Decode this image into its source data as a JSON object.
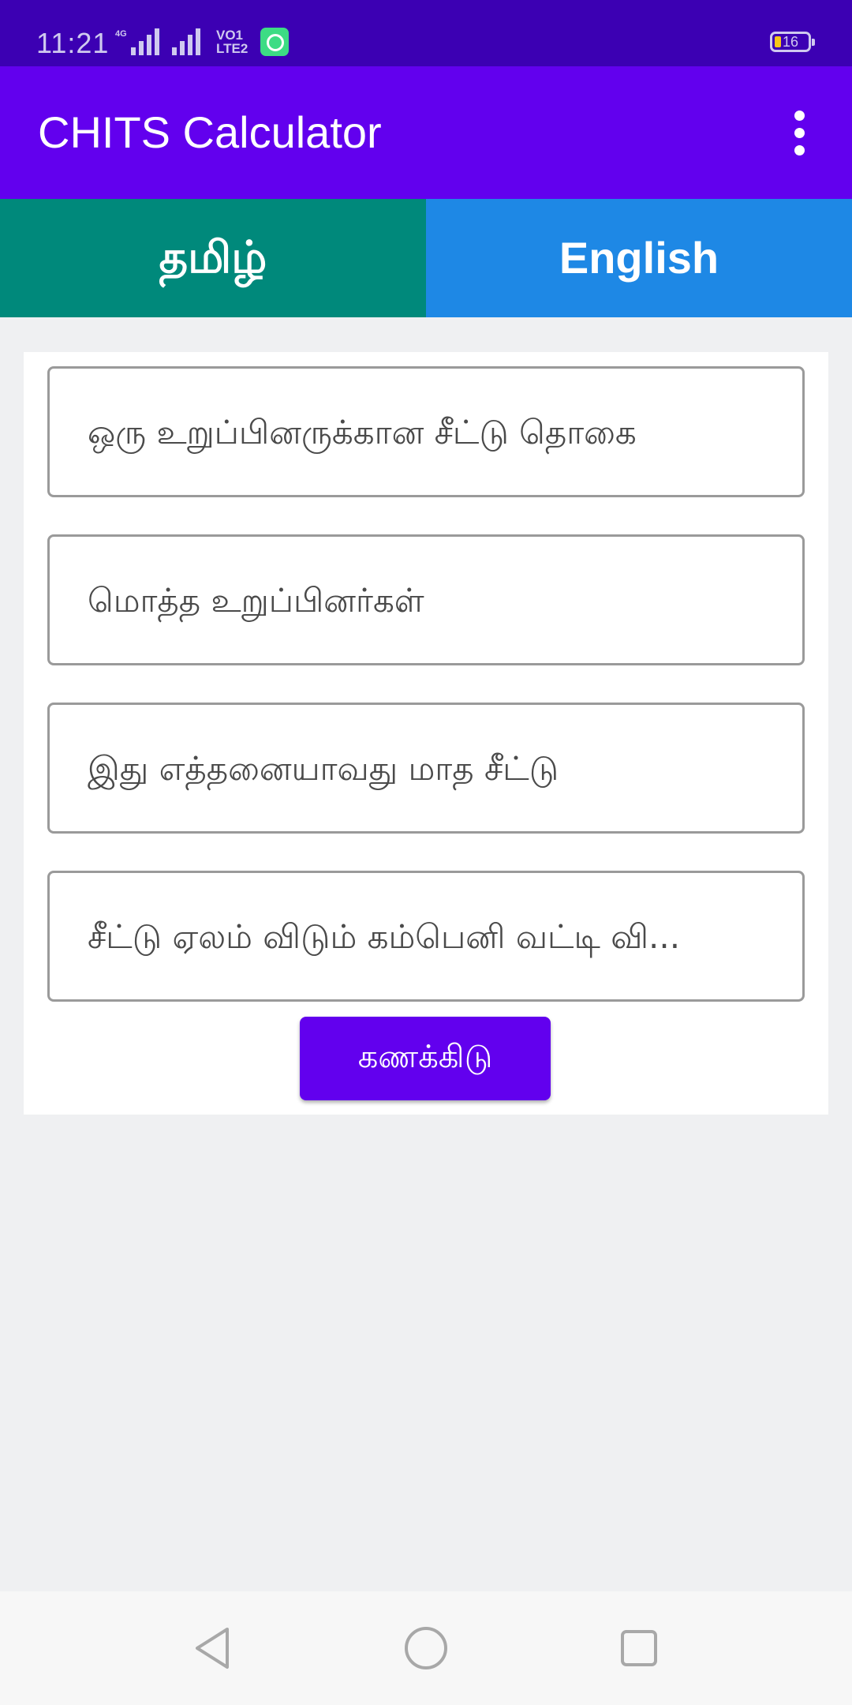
{
  "status_bar": {
    "time": "11:21",
    "network": "4G",
    "volte_line1": "VO1",
    "volte_line2": "LTE2",
    "battery_level": "16",
    "battery_color": "#f5c518"
  },
  "app_bar": {
    "title": "CHITS Calculator",
    "menu_icon": "more-vert-icon",
    "color": "#6200ee"
  },
  "language_tabs": [
    {
      "label": "தமிழ்",
      "color": "#00897b"
    },
    {
      "label": "English",
      "color": "#1e88e5"
    }
  ],
  "form": {
    "fields": [
      {
        "value": "",
        "placeholder": "ஒரு உறுப்பினருக்கான சீட்டு தொகை"
      },
      {
        "value": "",
        "placeholder": "மொத்த உறுப்பினர்கள்"
      },
      {
        "value": "",
        "placeholder": "இது எத்தனையாவது மாத சீட்டு"
      },
      {
        "value": "",
        "placeholder": "சீட்டு ஏலம் விடும் கம்பெனி வட்டி வி..."
      }
    ],
    "calculate_label": "கணக்கிடு"
  },
  "nav_bar": {
    "back_icon": "back-triangle-icon",
    "home_icon": "home-circle-icon",
    "recent_icon": "recent-square-icon"
  }
}
